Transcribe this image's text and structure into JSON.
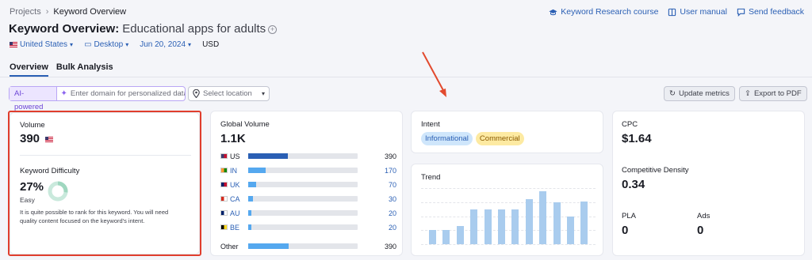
{
  "breadcrumb": {
    "root": "Projects",
    "current": "Keyword Overview"
  },
  "top_links": {
    "course": "Keyword Research course",
    "manual": "User manual",
    "feedback": "Send feedback"
  },
  "header": {
    "title": "Keyword Overview:",
    "keyword": "Educational apps for adults"
  },
  "filters": {
    "country": "United States",
    "device": "Desktop",
    "date": "Jun 20, 2024",
    "currency": "USD"
  },
  "tabs": [
    "Overview",
    "Bulk Analysis"
  ],
  "toolbar": {
    "ai_label": "AI-powered",
    "domain_placeholder": "Enter domain for personalized data",
    "location_placeholder": "Select location",
    "update_label": "Update metrics",
    "export_label": "Export to PDF"
  },
  "volume": {
    "label": "Volume",
    "value": "390",
    "kd_label": "Keyword Difficulty",
    "kd_value": "27%",
    "kd_percent": 27,
    "kd_level": "Easy",
    "kd_text": "It is quite possible to rank for this keyword. You will need quality content focused on the keyword's intent."
  },
  "global_volume": {
    "label": "Global Volume",
    "value": "1.1K",
    "countries": [
      {
        "code": "US",
        "value": "390",
        "share": 0.36,
        "color": "#2a5fb4"
      },
      {
        "code": "IN",
        "value": "170",
        "share": 0.16,
        "color": "#55a8ef"
      },
      {
        "code": "UK",
        "value": "70",
        "share": 0.07,
        "color": "#55a8ef"
      },
      {
        "code": "CA",
        "value": "30",
        "share": 0.04,
        "color": "#55a8ef"
      },
      {
        "code": "AU",
        "value": "20",
        "share": 0.03,
        "color": "#55a8ef"
      },
      {
        "code": "BE",
        "value": "20",
        "share": 0.03,
        "color": "#55a8ef"
      }
    ],
    "other": {
      "code": "Other",
      "value": "390",
      "share": 0.37,
      "color": "#55a8ef"
    }
  },
  "intent": {
    "label": "Intent",
    "tags": [
      "Informational",
      "Commercial"
    ],
    "colors": {
      "informational": "#cfe6fb",
      "commercial": "#fdeaa2"
    }
  },
  "trend": {
    "label": "Trend",
    "values": [
      0.26,
      0.26,
      0.32,
      0.62,
      0.62,
      0.62,
      0.62,
      0.8,
      0.94,
      0.74,
      0.5,
      0.76
    ]
  },
  "cpc": {
    "label": "CPC",
    "value": "$1.64"
  },
  "competitive_density": {
    "label": "Competitive Density",
    "value": "0.34"
  },
  "pla": {
    "label": "PLA",
    "value": "0"
  },
  "ads": {
    "label": "Ads",
    "value": "0"
  }
}
